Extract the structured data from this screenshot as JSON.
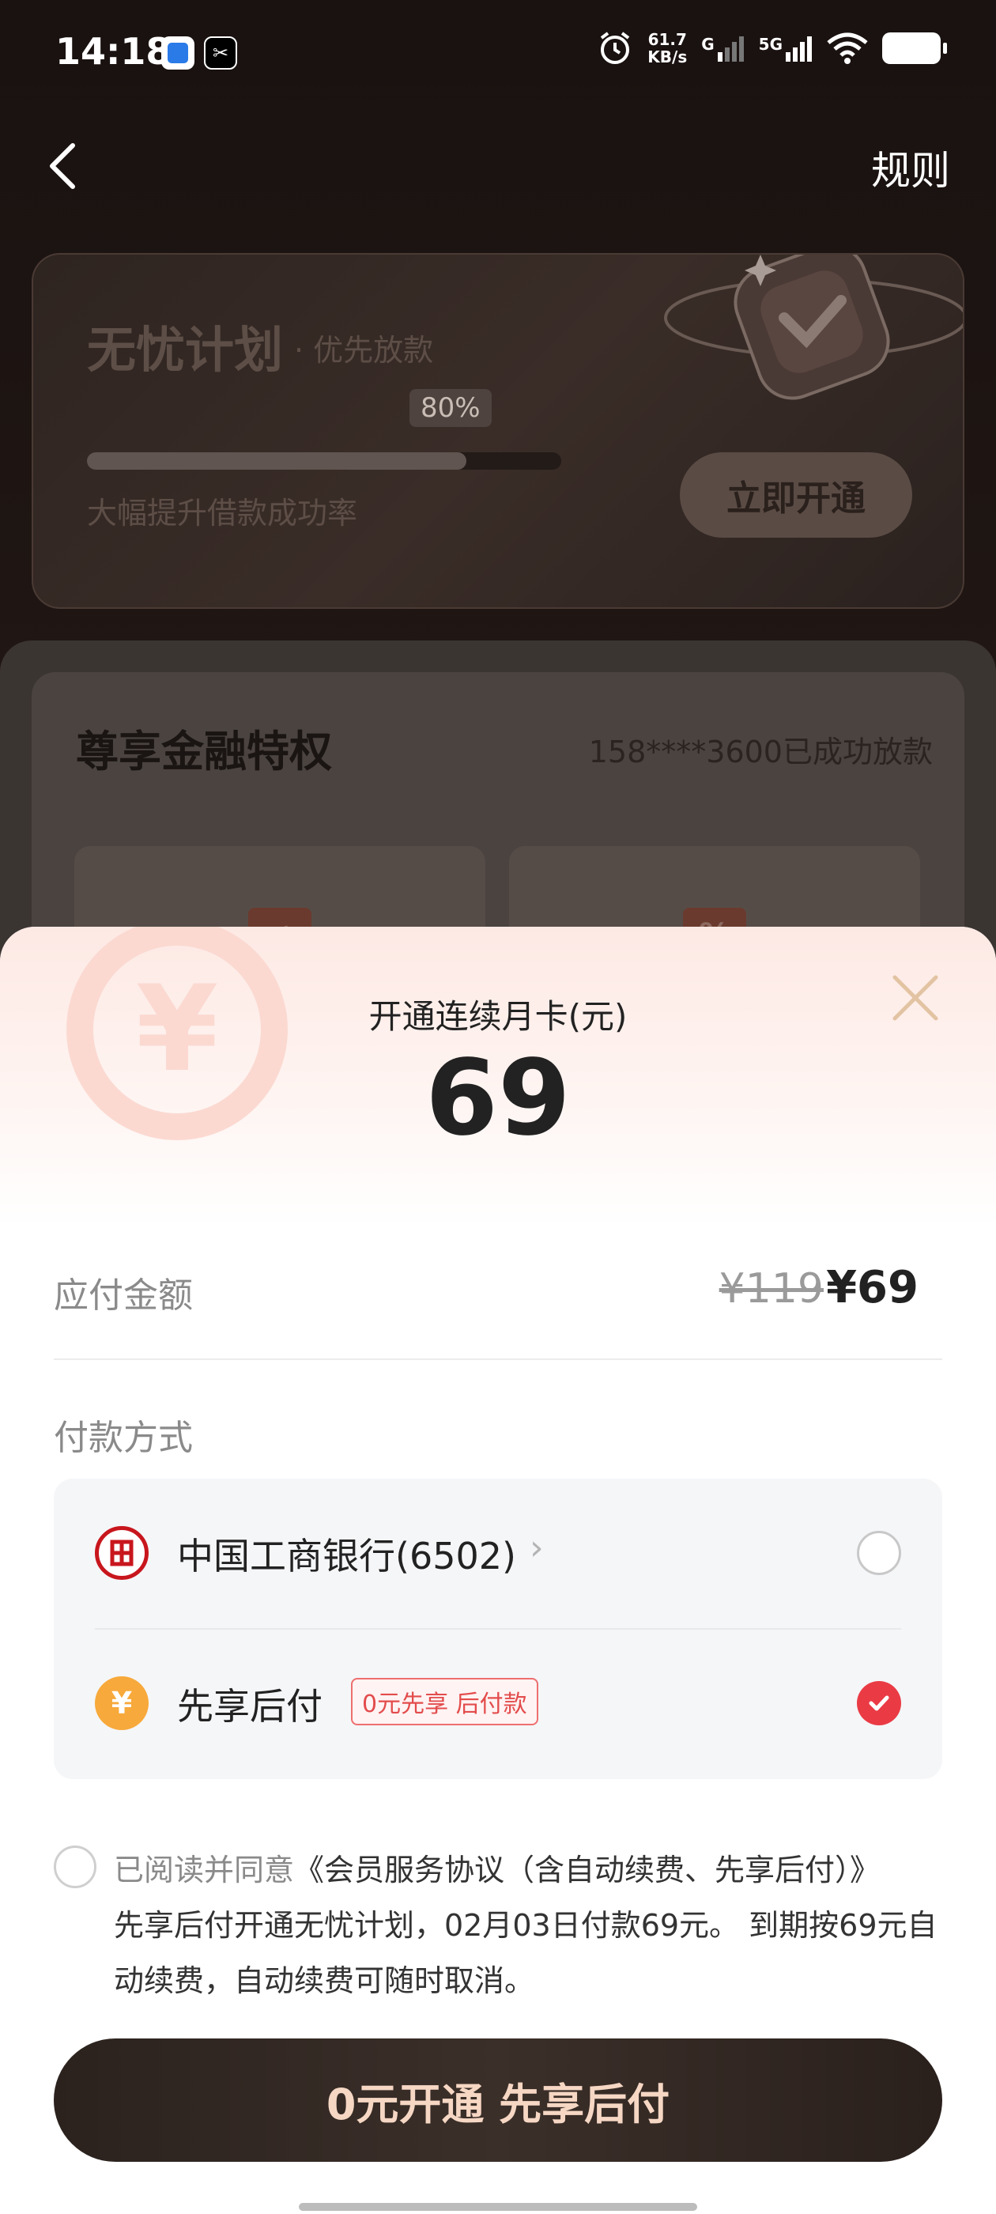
{
  "status": {
    "time": "14:18",
    "net_speed_value": "61.7",
    "net_speed_unit": "KB/s",
    "signal_a": "G",
    "signal_b": "5G"
  },
  "header": {
    "rule_label": "规则"
  },
  "plan": {
    "title": "无忧计划",
    "subtitle": "· 优先放款",
    "progress_label": "80%",
    "progress": 0.8,
    "description": "大幅提升借款成功率",
    "button_label": "立即开通"
  },
  "privilege": {
    "title": "尊享金融特权",
    "notice": "158****3600已成功放款",
    "tile2_icon": "%"
  },
  "sheet": {
    "label": "开通连续月卡(元)",
    "amount": "69",
    "payable_label": "应付金额",
    "original_price": "¥119",
    "price": "¥69",
    "method_title": "付款方式",
    "methods": [
      {
        "name": "中国工商银行(6502)",
        "icon": "icbc-bank-icon",
        "selected": false
      },
      {
        "name": "先享后付",
        "icon": "yen-coin-icon",
        "tag": "0元先享 后付款",
        "selected": true
      }
    ],
    "agreement_prefix": "已阅读并同意",
    "agreement_link": "《会员服务协议（含自动续费、先享后付）》",
    "agreement_detail": "先享后付开通无忧计划，02月03日付款69元。 到期按69元自动续费，自动续费可随时取消。",
    "cta_label": "0元开通 先享后付"
  },
  "colors": {
    "accent_red": "#ea3b45",
    "cta_text": "#f6d7c4",
    "dark_bg": "#1a1210"
  }
}
